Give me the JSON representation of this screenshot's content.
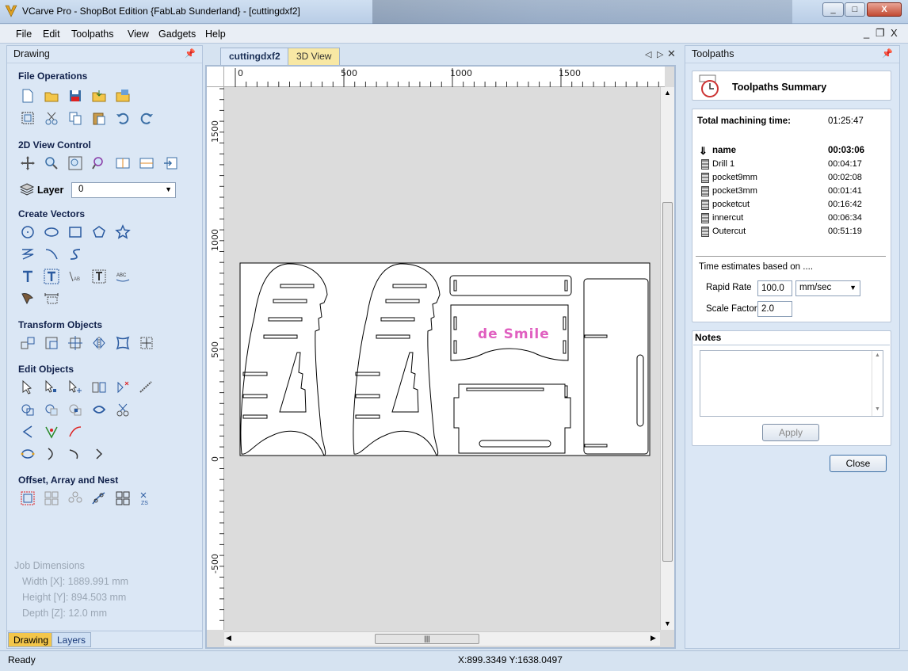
{
  "window": {
    "title": "VCarve Pro - ShopBot Edition {FabLab Sunderland} - [cuttingdxf2]",
    "buttons": [
      "_",
      "□",
      "X"
    ]
  },
  "menubar": {
    "items": [
      "File",
      "Edit",
      "Toolpaths",
      "View",
      "Gadgets",
      "Help"
    ],
    "mdi_buttons": [
      "_",
      "❐",
      "X"
    ]
  },
  "left_panel": {
    "title": "Drawing",
    "sections": {
      "file_operations": "File Operations",
      "view_control": "2D View Control",
      "create_vectors": "Create Vectors",
      "transform_objects": "Transform Objects",
      "edit_objects": "Edit Objects",
      "offset_array_nest": "Offset, Array and Nest"
    },
    "layer": {
      "label": "Layer",
      "value": "0"
    },
    "job_dimensions": {
      "title": "Job Dimensions",
      "width": "Width  [X]: 1889.991 mm",
      "height": "Height [Y]: 894.503 mm",
      "depth": "Depth  [Z]: 12.0 mm"
    },
    "bottom_tabs": [
      "Drawing",
      "Layers"
    ]
  },
  "document": {
    "tabs": [
      "cuttingdxf2",
      "3D View"
    ],
    "ruler_h_labels": [
      "0",
      "500",
      "1000",
      "1500"
    ],
    "ruler_v_labels": [
      "1500",
      "1000",
      "500",
      "0",
      "-500"
    ],
    "engraved_text": "de Smile"
  },
  "right_panel": {
    "title": "Toolpaths",
    "summary_title": "Toolpaths Summary",
    "total_label": "Total machining time:",
    "total_time": "01:25:47",
    "header": {
      "name": "name",
      "time": "00:03:06"
    },
    "toolpaths": [
      {
        "name": "Drill 1",
        "time": "00:04:17"
      },
      {
        "name": "pocket9mm",
        "time": "00:02:08"
      },
      {
        "name": "pocket3mm",
        "time": "00:01:41"
      },
      {
        "name": "pocketcut",
        "time": "00:16:42"
      },
      {
        "name": "innercut",
        "time": "00:06:34"
      },
      {
        "name": "Outercut",
        "time": "00:51:19"
      }
    ],
    "estimates_label": "Time estimates based on ....",
    "rapid_rate_label": "Rapid Rate",
    "rapid_rate_value": "100.0",
    "rapid_rate_unit": "mm/sec",
    "scale_factor_label": "Scale Factor",
    "scale_factor_value": "2.0",
    "notes_title": "Notes",
    "apply_label": "Apply",
    "close_label": "Close"
  },
  "status": {
    "left": "Ready",
    "coords": "X:899.3349 Y:1638.0497"
  },
  "colors": {
    "accent": "#dbe7f5",
    "engraved_text": "#e060c0"
  }
}
